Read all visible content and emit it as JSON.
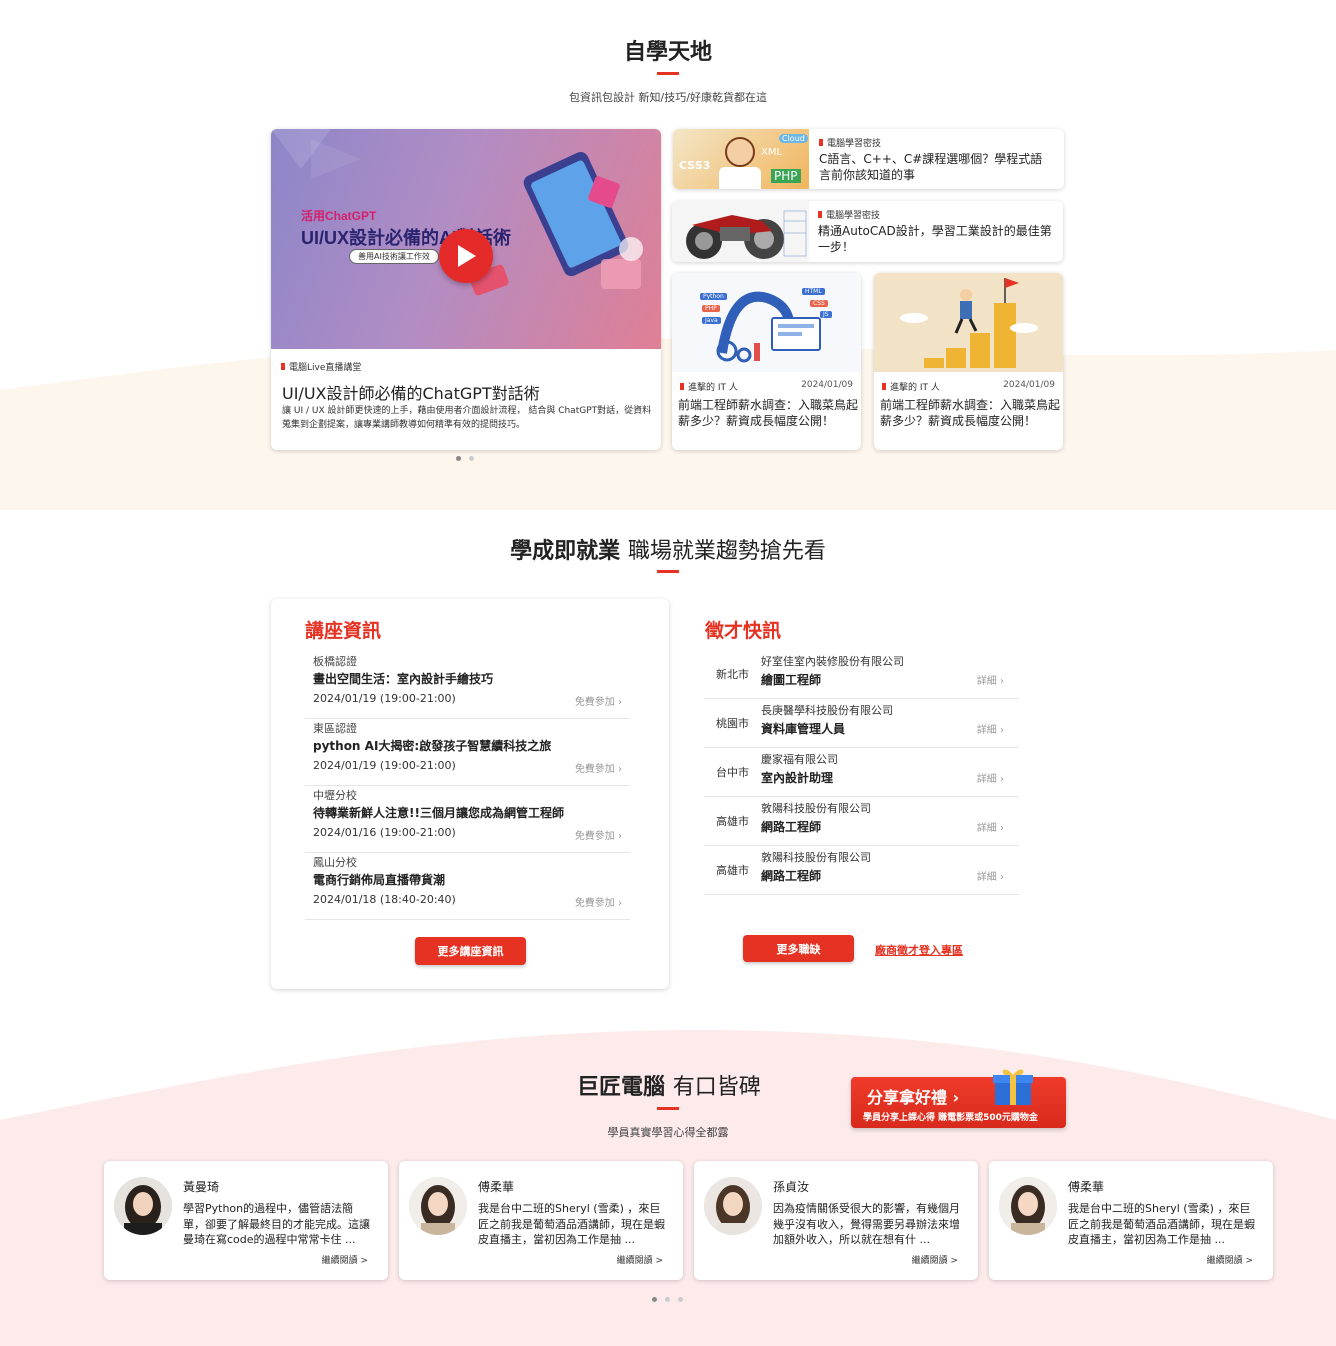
{
  "section1": {
    "title": "自學天地",
    "subtitle": "包資訊包設計 新知/技巧/好康乾貨都在這",
    "featured": {
      "image_title_small": "活用ChatGPT",
      "image_title_big": "UI/UX設計必備的AI對話術",
      "image_caption": "善用AI技術讓工作效",
      "tag": "電腦Live直播講堂",
      "title": "UI/UX設計師必備的ChatGPT對話術",
      "desc": "讓 UI / UX 設計師更快速的上手，藉由使用者介面設計流程， 結合與 ChatGPT對話，從資料蒐集到企劃提案，讓專業講師教導如何精準有效的提問技巧。"
    },
    "side_articles": [
      {
        "tag": "電腦學習密技",
        "title": "C語言、C++、C#課程選哪個？學程式語言前你該知道的事",
        "image_labels": [
          "CSS3",
          "XML",
          "PHP",
          "Cloud"
        ]
      },
      {
        "tag": "電腦學習密技",
        "title": "精通AutoCAD設計，學習工業設計的最佳第一步！"
      }
    ],
    "small_articles": [
      {
        "tag": "進擊的 IT 人",
        "date": "2024/01/09",
        "title": "前端工程師薪水調查：入職菜鳥起薪多少？薪資成長幅度公開！",
        "image_labels": [
          "Python",
          "PHP",
          "Java",
          "HTML",
          "CSS",
          "JS"
        ]
      },
      {
        "tag": "進擊的 IT 人",
        "date": "2024/01/09",
        "title": "前端工程師薪水調查：入職菜鳥起薪多少？薪資成長幅度公開！"
      }
    ]
  },
  "section2": {
    "title_bold": "學成即就業",
    "title_light": "職場就業趨勢搶先看",
    "seminar_panel": {
      "title": "講座資訊",
      "items": [
        {
          "location": "板橋認證",
          "name": "畫出空間生活：室內設計手繪技巧",
          "time": "2024/01/19 (19:00-21:00)",
          "join": "免費參加 ›"
        },
        {
          "location": "東區認證",
          "name": "python AI大揭密:啟發孩子智慧續科技之旅",
          "time": "2024/01/19 (19:00-21:00)",
          "join": "免費參加 ›"
        },
        {
          "location": "中壢分校",
          "name": "待轉業新鮮人注意!!三個月讓您成為網管工程師",
          "time": "2024/01/16 (19:00-21:00)",
          "join": "免費參加 ›"
        },
        {
          "location": "鳳山分校",
          "name": "電商行銷佈局直播帶貨潮",
          "time": "2024/01/18 (18:40-20:40)",
          "join": "免費參加 ›"
        }
      ],
      "more_button": "更多講座資訊"
    },
    "jobs_panel": {
      "title": "徵才快訊",
      "items": [
        {
          "city": "新北市",
          "company": "好室佳室內裝修股份有限公司",
          "title": "繪圖工程師",
          "detail": "詳細 ›"
        },
        {
          "city": "桃園市",
          "company": "長庚醫學科技股份有限公司",
          "title": "資料庫管理人員",
          "detail": "詳細 ›"
        },
        {
          "city": "台中市",
          "company": "慶家福有限公司",
          "title": "室內設計助理",
          "detail": "詳細 ›"
        },
        {
          "city": "高雄市",
          "company": "敦陽科技股份有限公司",
          "title": "網路工程師",
          "detail": "詳細 ›"
        },
        {
          "city": "高雄市",
          "company": "敦陽科技股份有限公司",
          "title": "網路工程師",
          "detail": "詳細 ›"
        }
      ],
      "more_button": "更多職缺",
      "employer_link": "廠商徵才登入專區"
    }
  },
  "section3": {
    "title_bold": "巨匠電腦",
    "title_light": "有口皆碑",
    "subtitle": "學員真實學習心得全都露",
    "promo": {
      "title": "分享拿好禮 ›",
      "subtitle": "學員分享上課心得 賺電影票或500元購物金"
    },
    "testimonials": [
      {
        "name": "黃曼琦",
        "text": "學習Python的過程中，儘管語法簡單，卻要了解最終目的才能完成。這讓曼琦在寫code的過程中常常卡住 ...",
        "more": "繼續閱讀 >"
      },
      {
        "name": "傅柔華",
        "text": "我是台中二班的Sheryl (雪柔) ，來巨匠之前我是葡萄酒品酒講師，現在是蝦皮直播主，當初因為工作是抽 ...",
        "more": "繼續閱讀 >"
      },
      {
        "name": "孫貞汝",
        "text": "因為疫情關係受很大的影響，有幾個月幾乎沒有收入，覺得需要另尋辦法來增加額外收入，所以就在想有什 ...",
        "more": "繼續閱讀 >"
      },
      {
        "name": "傅柔華",
        "text": "我是台中二班的Sheryl (雪柔) ，來巨匠之前我是葡萄酒品酒講師，現在是蝦皮直播主，當初因為工作是抽 ...",
        "more": "繼續閱讀 >"
      }
    ]
  },
  "colors": {
    "accent": "#e53222",
    "cream": "#fdf6ec",
    "pink": "#fdeaea"
  }
}
